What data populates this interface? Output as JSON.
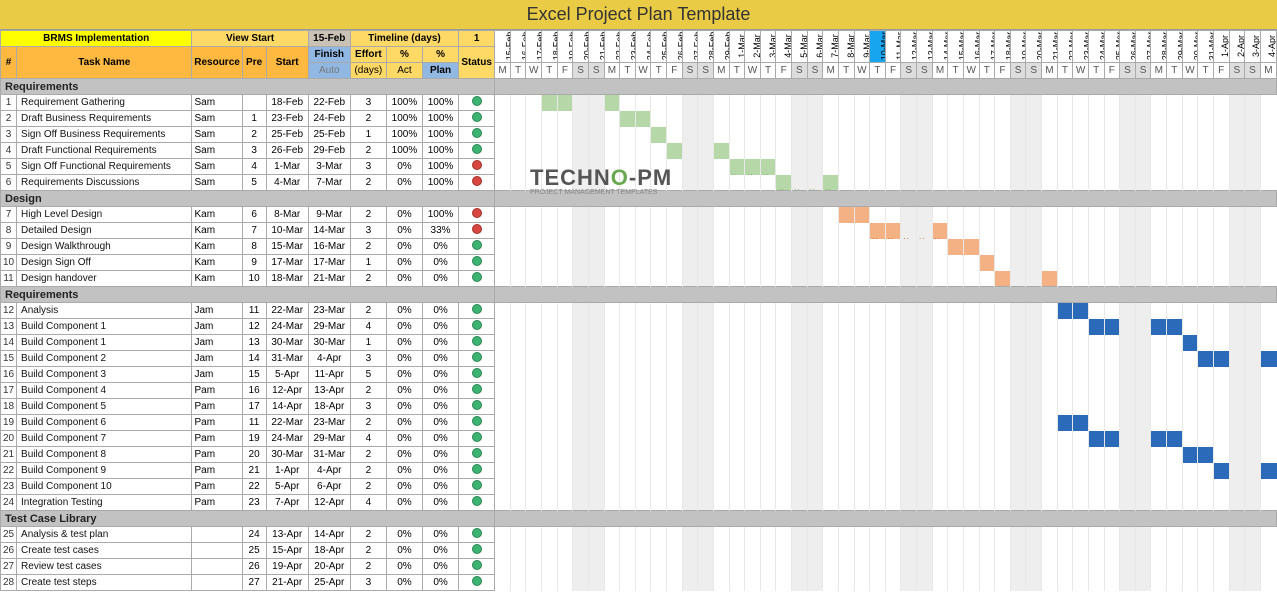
{
  "title": "Excel Project Plan Template",
  "header": {
    "project_label": "BRMS Implementation",
    "view_start_label": "View Start",
    "view_start_date": "15-Feb",
    "timeline_label": "Timeline (days)",
    "timeline_num": "1",
    "cols": {
      "num": "#",
      "task": "Task Name",
      "resource": "Resource",
      "pre": "Pre",
      "start": "Start",
      "finish": "Finish",
      "auto": "Auto",
      "effort": "Effort",
      "days": "(days)",
      "pct": "%",
      "act": "Act",
      "plan": "Plan",
      "status": "Status"
    }
  },
  "timeline": {
    "dates": [
      "15-Feb",
      "16-Feb",
      "17-Feb",
      "18-Feb",
      "19-Feb",
      "20-Feb",
      "21-Feb",
      "22-Feb",
      "23-Feb",
      "24-Feb",
      "25-Feb",
      "26-Feb",
      "27-Feb",
      "28-Feb",
      "29-Feb",
      "1-Mar",
      "2-Mar",
      "3-Mar",
      "4-Mar",
      "5-Mar",
      "6-Mar",
      "7-Mar",
      "8-Mar",
      "9-Mar",
      "10-Mar",
      "11-Mar",
      "12-Mar",
      "13-Mar",
      "14-Mar",
      "15-Mar",
      "16-Mar",
      "17-Mar",
      "18-Mar",
      "19-Mar",
      "20-Mar",
      "21-Mar",
      "22-Mar",
      "23-Mar",
      "24-Mar",
      "25-Mar",
      "26-Mar",
      "27-Mar",
      "28-Mar",
      "29-Mar",
      "30-Mar",
      "31-Mar",
      "1-Apr",
      "2-Apr",
      "3-Apr",
      "4-Apr"
    ],
    "dows": [
      "M",
      "T",
      "W",
      "T",
      "F",
      "S",
      "S",
      "M",
      "T",
      "W",
      "T",
      "F",
      "S",
      "S",
      "M",
      "T",
      "W",
      "T",
      "F",
      "S",
      "S",
      "M",
      "T",
      "W",
      "T",
      "F",
      "S",
      "S",
      "M",
      "T",
      "W",
      "T",
      "F",
      "S",
      "S",
      "M",
      "T",
      "W",
      "T",
      "F",
      "S",
      "S",
      "M",
      "T",
      "W",
      "T",
      "F",
      "S",
      "S",
      "M"
    ],
    "today_index": 24
  },
  "sections": [
    {
      "label": "Requirements",
      "tasks": [
        {
          "n": "1",
          "name": "Requirement Gathering",
          "res": "Sam",
          "pre": "",
          "start": "18-Feb",
          "finish": "22-Feb",
          "effort": "3",
          "act": "100%",
          "plan": "100%",
          "status": "green",
          "bar": {
            "from": 3,
            "to": 7,
            "style": "green"
          }
        },
        {
          "n": "2",
          "name": "Draft Business Requirements",
          "res": "Sam",
          "pre": "1",
          "start": "23-Feb",
          "finish": "24-Feb",
          "effort": "2",
          "act": "100%",
          "plan": "100%",
          "status": "green",
          "bar": {
            "from": 8,
            "to": 9,
            "style": "green"
          }
        },
        {
          "n": "3",
          "name": "Sign Off Business Requirements",
          "res": "Sam",
          "pre": "2",
          "start": "25-Feb",
          "finish": "25-Feb",
          "effort": "1",
          "act": "100%",
          "plan": "100%",
          "status": "green",
          "bar": {
            "from": 10,
            "to": 10,
            "style": "green"
          }
        },
        {
          "n": "4",
          "name": "Draft Functional Requirements",
          "res": "Sam",
          "pre": "3",
          "start": "26-Feb",
          "finish": "29-Feb",
          "effort": "2",
          "act": "100%",
          "plan": "100%",
          "status": "green",
          "bar": {
            "from": 11,
            "to": 14,
            "style": "green"
          }
        },
        {
          "n": "5",
          "name": "Sign Off Functional Requirements",
          "res": "Sam",
          "pre": "4",
          "start": "1-Mar",
          "finish": "3-Mar",
          "effort": "3",
          "act": "0%",
          "plan": "100%",
          "status": "red",
          "bar": {
            "from": 15,
            "to": 17,
            "style": "green-d"
          }
        },
        {
          "n": "6",
          "name": "Requirements Discussions",
          "res": "Sam",
          "pre": "5",
          "start": "4-Mar",
          "finish": "7-Mar",
          "effort": "2",
          "act": "0%",
          "plan": "100%",
          "status": "red",
          "bar": {
            "from": 18,
            "to": 21,
            "style": "green-d"
          }
        }
      ]
    },
    {
      "label": "Design",
      "tasks": [
        {
          "n": "7",
          "name": "High Level Design",
          "res": "Kam",
          "pre": "6",
          "start": "8-Mar",
          "finish": "9-Mar",
          "effort": "2",
          "act": "0%",
          "plan": "100%",
          "status": "red",
          "bar": {
            "from": 22,
            "to": 23,
            "style": "orange"
          }
        },
        {
          "n": "8",
          "name": "Detailed Design",
          "res": "Kam",
          "pre": "7",
          "start": "10-Mar",
          "finish": "14-Mar",
          "effort": "3",
          "act": "0%",
          "plan": "33%",
          "status": "red",
          "bar": {
            "from": 24,
            "to": 28,
            "style": "orange-d"
          }
        },
        {
          "n": "9",
          "name": "Design Walkthrough",
          "res": "Kam",
          "pre": "8",
          "start": "15-Mar",
          "finish": "16-Mar",
          "effort": "2",
          "act": "0%",
          "plan": "0%",
          "status": "green",
          "bar": {
            "from": 29,
            "to": 30,
            "style": "orange"
          }
        },
        {
          "n": "10",
          "name": "Design Sign Off",
          "res": "Kam",
          "pre": "9",
          "start": "17-Mar",
          "finish": "17-Mar",
          "effort": "1",
          "act": "0%",
          "plan": "0%",
          "status": "green",
          "bar": {
            "from": 31,
            "to": 31,
            "style": "orange"
          }
        },
        {
          "n": "11",
          "name": "Design handover",
          "res": "Kam",
          "pre": "10",
          "start": "18-Mar",
          "finish": "21-Mar",
          "effort": "2",
          "act": "0%",
          "plan": "0%",
          "status": "green",
          "bar": {
            "from": 32,
            "to": 35,
            "style": "orange"
          }
        }
      ]
    },
    {
      "label": "Requirements",
      "tasks": [
        {
          "n": "12",
          "name": "Analysis",
          "res": "Jam",
          "pre": "11",
          "start": "22-Mar",
          "finish": "23-Mar",
          "effort": "2",
          "act": "0%",
          "plan": "0%",
          "status": "green",
          "bar": {
            "from": 36,
            "to": 37,
            "style": "blue"
          }
        },
        {
          "n": "13",
          "name": "Build Component 1",
          "res": "Jam",
          "pre": "12",
          "start": "24-Mar",
          "finish": "29-Mar",
          "effort": "4",
          "act": "0%",
          "plan": "0%",
          "status": "green",
          "bar": {
            "from": 38,
            "to": 43,
            "style": "blue"
          }
        },
        {
          "n": "14",
          "name": "Build Component 1",
          "res": "Jam",
          "pre": "13",
          "start": "30-Mar",
          "finish": "30-Mar",
          "effort": "1",
          "act": "0%",
          "plan": "0%",
          "status": "green",
          "bar": {
            "from": 44,
            "to": 44,
            "style": "blue"
          }
        },
        {
          "n": "15",
          "name": "Build Component 2",
          "res": "Jam",
          "pre": "14",
          "start": "31-Mar",
          "finish": "4-Apr",
          "effort": "3",
          "act": "0%",
          "plan": "0%",
          "status": "green",
          "bar": {
            "from": 45,
            "to": 49,
            "style": "blue"
          }
        },
        {
          "n": "16",
          "name": "Build Component 3",
          "res": "Jam",
          "pre": "15",
          "start": "5-Apr",
          "finish": "11-Apr",
          "effort": "5",
          "act": "0%",
          "plan": "0%",
          "status": "green",
          "bar": null
        },
        {
          "n": "17",
          "name": "Build Component 4",
          "res": "Pam",
          "pre": "16",
          "start": "12-Apr",
          "finish": "13-Apr",
          "effort": "2",
          "act": "0%",
          "plan": "0%",
          "status": "green",
          "bar": null
        },
        {
          "n": "18",
          "name": "Build Component 5",
          "res": "Pam",
          "pre": "17",
          "start": "14-Apr",
          "finish": "18-Apr",
          "effort": "3",
          "act": "0%",
          "plan": "0%",
          "status": "green",
          "bar": null
        },
        {
          "n": "19",
          "name": "Build Component 6",
          "res": "Pam",
          "pre": "11",
          "start": "22-Mar",
          "finish": "23-Mar",
          "effort": "2",
          "act": "0%",
          "plan": "0%",
          "status": "green",
          "bar": {
            "from": 36,
            "to": 37,
            "style": "blue"
          }
        },
        {
          "n": "20",
          "name": "Build Component 7",
          "res": "Pam",
          "pre": "19",
          "start": "24-Mar",
          "finish": "29-Mar",
          "effort": "4",
          "act": "0%",
          "plan": "0%",
          "status": "green",
          "bar": {
            "from": 38,
            "to": 43,
            "style": "blue"
          }
        },
        {
          "n": "21",
          "name": "Build Component 8",
          "res": "Pam",
          "pre": "20",
          "start": "30-Mar",
          "finish": "31-Mar",
          "effort": "2",
          "act": "0%",
          "plan": "0%",
          "status": "green",
          "bar": {
            "from": 44,
            "to": 45,
            "style": "blue"
          }
        },
        {
          "n": "22",
          "name": "Build Component 9",
          "res": "Pam",
          "pre": "21",
          "start": "1-Apr",
          "finish": "4-Apr",
          "effort": "2",
          "act": "0%",
          "plan": "0%",
          "status": "green",
          "bar": {
            "from": 46,
            "to": 49,
            "style": "blue"
          }
        },
        {
          "n": "23",
          "name": "Build Component 10",
          "res": "Pam",
          "pre": "22",
          "start": "5-Apr",
          "finish": "6-Apr",
          "effort": "2",
          "act": "0%",
          "plan": "0%",
          "status": "green",
          "bar": null
        },
        {
          "n": "24",
          "name": "Integration Testing",
          "res": "Pam",
          "pre": "23",
          "start": "7-Apr",
          "finish": "12-Apr",
          "effort": "4",
          "act": "0%",
          "plan": "0%",
          "status": "green",
          "bar": null
        }
      ]
    },
    {
      "label": "Test Case Library",
      "tasks": [
        {
          "n": "25",
          "name": "Analysis & test plan",
          "res": "",
          "pre": "24",
          "start": "13-Apr",
          "finish": "14-Apr",
          "effort": "2",
          "act": "0%",
          "plan": "0%",
          "status": "green",
          "bar": null
        },
        {
          "n": "26",
          "name": "Create test cases",
          "res": "",
          "pre": "25",
          "start": "15-Apr",
          "finish": "18-Apr",
          "effort": "2",
          "act": "0%",
          "plan": "0%",
          "status": "green",
          "bar": null
        },
        {
          "n": "27",
          "name": "Review test cases",
          "res": "",
          "pre": "26",
          "start": "19-Apr",
          "finish": "20-Apr",
          "effort": "2",
          "act": "0%",
          "plan": "0%",
          "status": "green",
          "bar": null
        },
        {
          "n": "28",
          "name": "Create test steps",
          "res": "",
          "pre": "27",
          "start": "21-Apr",
          "finish": "25-Apr",
          "effort": "3",
          "act": "0%",
          "plan": "0%",
          "status": "green",
          "bar": null
        }
      ]
    }
  ],
  "watermark": {
    "main1": "TECHN",
    "main2": "O",
    "main3": "-PM",
    "sub": "PROJECT MANAGEMENT TEMPLATES"
  }
}
